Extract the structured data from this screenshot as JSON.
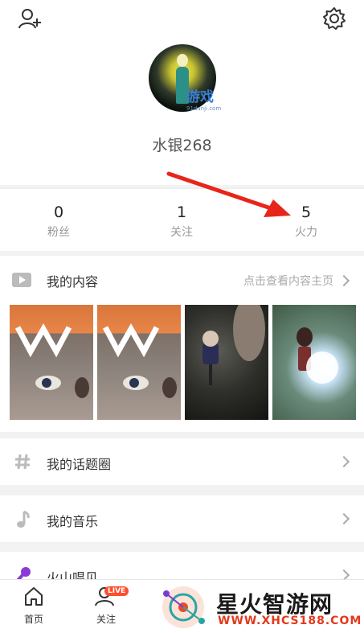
{
  "profile": {
    "username": "水银268",
    "watermark": "游戏",
    "watermark_sub": "91danji.com"
  },
  "stats": [
    {
      "value": "0",
      "label": "粉丝"
    },
    {
      "value": "1",
      "label": "关注"
    },
    {
      "value": "5",
      "label": "火力"
    }
  ],
  "content": {
    "title": "我的内容",
    "link": "点击查看内容主页"
  },
  "menu": [
    {
      "label": "我的话题圈",
      "icon": "hash-icon"
    },
    {
      "label": "我的音乐",
      "icon": "music-note-icon"
    },
    {
      "label": "火山唱见",
      "icon": "microphone-icon"
    }
  ],
  "tabbar": {
    "home": "首页",
    "follow": "关注",
    "live_badge": "LIVE"
  },
  "brand": {
    "name": "星火智游网",
    "url": "WWW.XHCS188.COM"
  },
  "colors": {
    "arrow": "#e8251a",
    "live": "#ff4d2d",
    "accent_purple": "#8a3ad6"
  }
}
